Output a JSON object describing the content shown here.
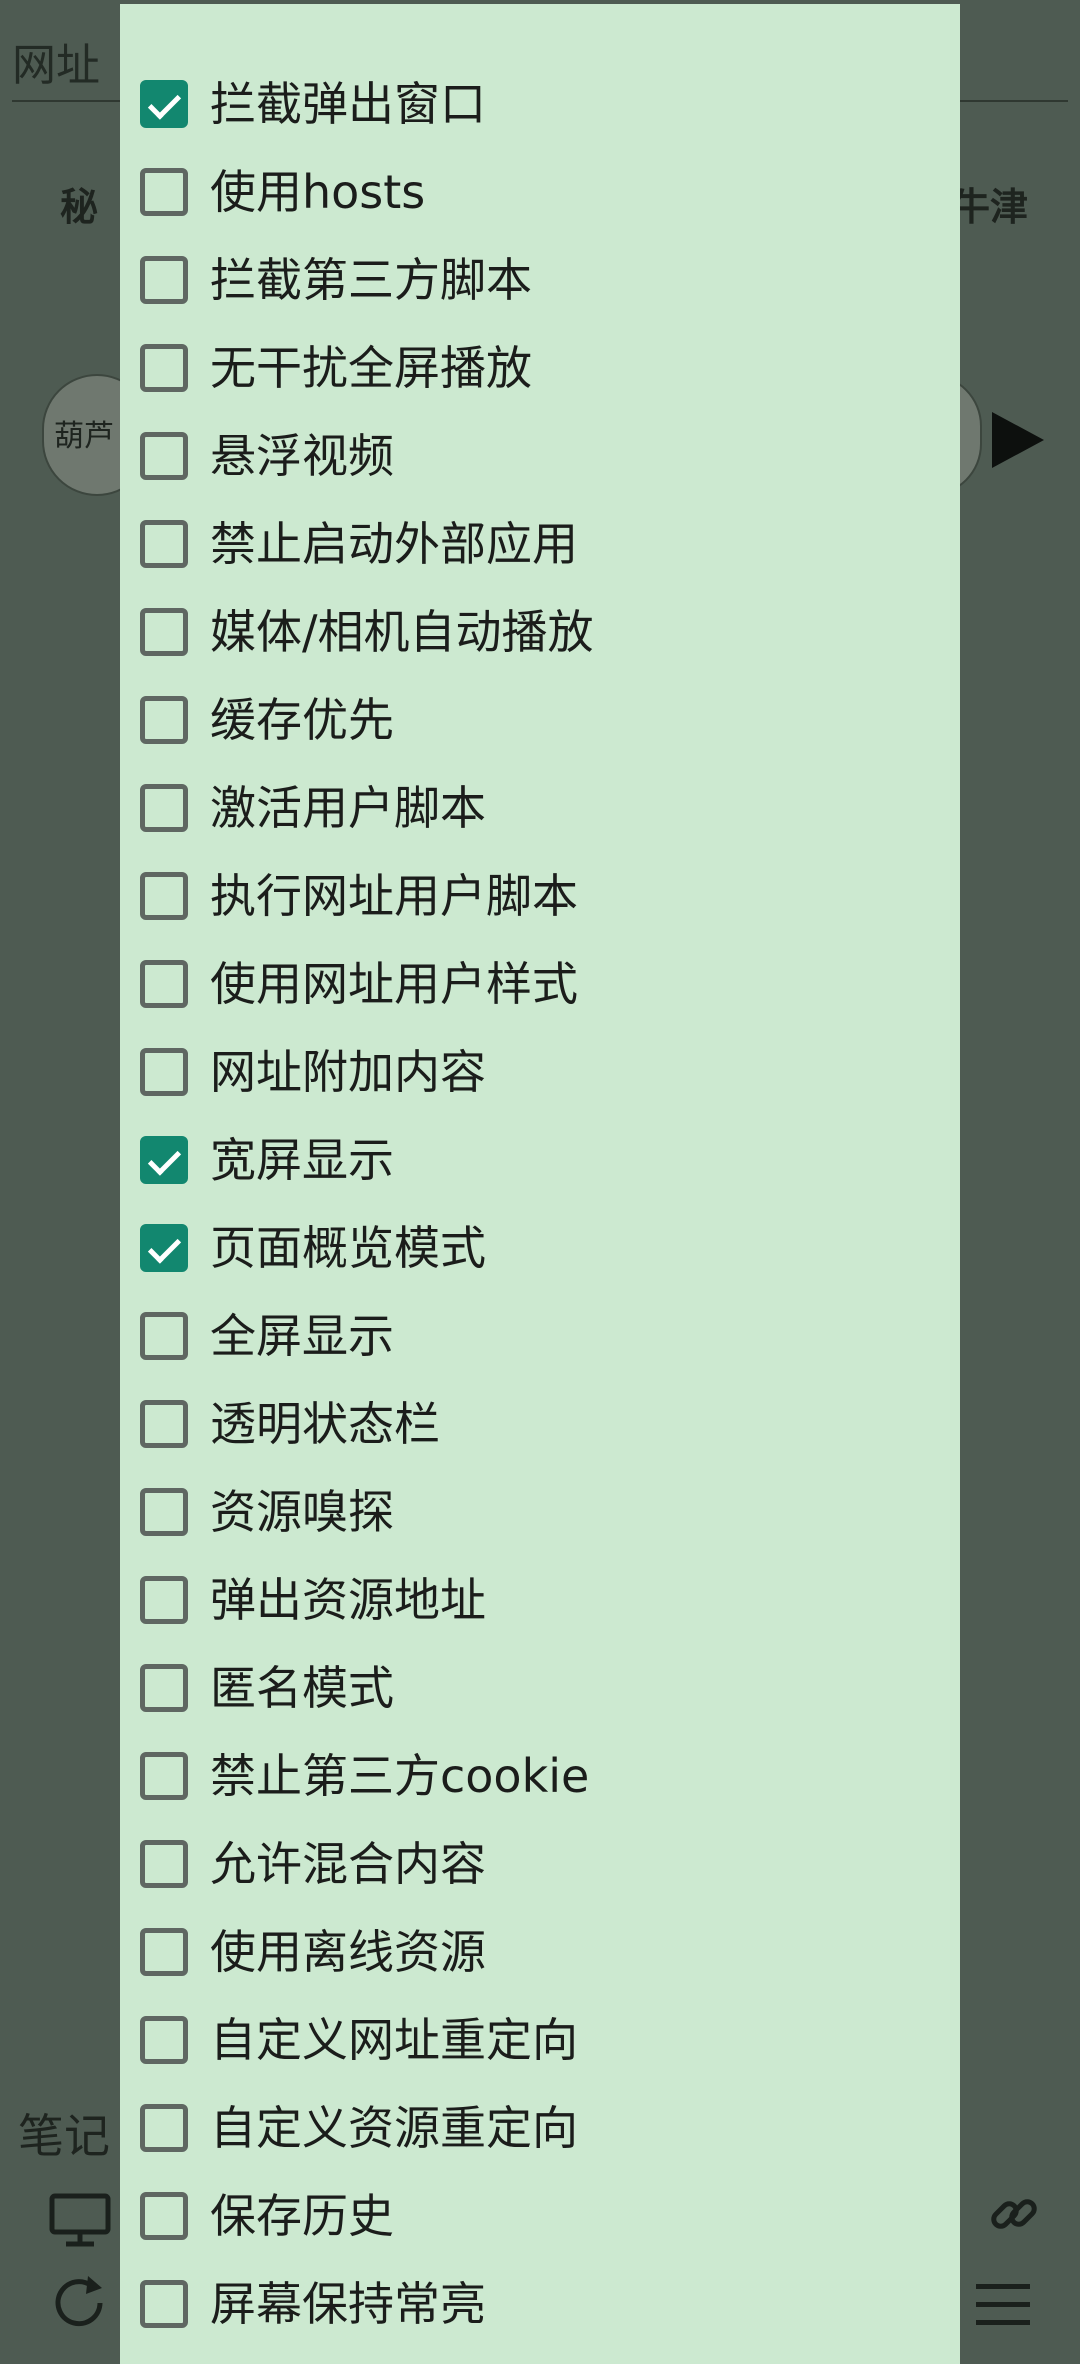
{
  "background": {
    "url_field_text": "网址",
    "left_label": "秘",
    "right_label": "牛津",
    "pill_text": "葫芦",
    "bottom_label": "笔记"
  },
  "menu": {
    "items": [
      {
        "label": "拦截弹出窗口",
        "checked": true
      },
      {
        "label": "使用hosts",
        "checked": false
      },
      {
        "label": "拦截第三方脚本",
        "checked": false
      },
      {
        "label": "无干扰全屏播放",
        "checked": false
      },
      {
        "label": "悬浮视频",
        "checked": false
      },
      {
        "label": "禁止启动外部应用",
        "checked": false
      },
      {
        "label": "媒体/相机自动播放",
        "checked": false
      },
      {
        "label": "缓存优先",
        "checked": false
      },
      {
        "label": "激活用户脚本",
        "checked": false
      },
      {
        "label": "执行网址用户脚本",
        "checked": false
      },
      {
        "label": "使用网址用户样式",
        "checked": false
      },
      {
        "label": "网址附加内容",
        "checked": false
      },
      {
        "label": "宽屏显示",
        "checked": true
      },
      {
        "label": "页面概览模式",
        "checked": true
      },
      {
        "label": "全屏显示",
        "checked": false
      },
      {
        "label": "透明状态栏",
        "checked": false
      },
      {
        "label": "资源嗅探",
        "checked": false
      },
      {
        "label": "弹出资源地址",
        "checked": false
      },
      {
        "label": "匿名模式",
        "checked": false
      },
      {
        "label": "禁止第三方cookie",
        "checked": false
      },
      {
        "label": "允许混合内容",
        "checked": false
      },
      {
        "label": "使用离线资源",
        "checked": false
      },
      {
        "label": "自定义网址重定向",
        "checked": false
      },
      {
        "label": "自定义资源重定向",
        "checked": false
      },
      {
        "label": "保存历史",
        "checked": false
      },
      {
        "label": "屏幕保持常亮",
        "checked": false
      }
    ]
  },
  "colors": {
    "scrim": "#4e5b52",
    "drawer_background": "#cce9d0",
    "checkbox_checked": "#12876f",
    "checkbox_unchecked_border": "#5f6762"
  },
  "icons": {
    "desktop": "desktop-icon",
    "refresh": "refresh-icon",
    "link": "link-icon",
    "menu": "hamburger-menu-icon",
    "play": "play-icon"
  }
}
